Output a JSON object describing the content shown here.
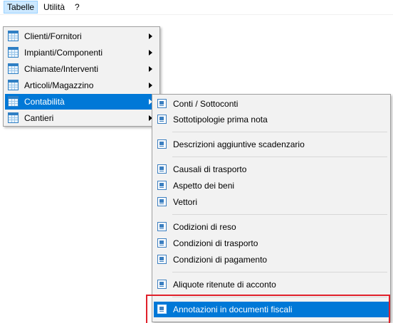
{
  "menubar": {
    "tabelle": "Tabelle",
    "utilita": "Utilità",
    "help": "?"
  },
  "menu_main": {
    "items": [
      {
        "label": "Clienti/Fornitori",
        "icon": "table-icon",
        "submenu": true
      },
      {
        "label": "Impianti/Componenti",
        "icon": "table-icon",
        "submenu": true
      },
      {
        "label": "Chiamate/Interventi",
        "icon": "table-icon",
        "submenu": true
      },
      {
        "label": "Articoli/Magazzino",
        "icon": "table-icon",
        "submenu": true
      },
      {
        "label": "Contabilità",
        "icon": "table-icon",
        "submenu": true,
        "highlighted": true
      },
      {
        "label": "Cantieri",
        "icon": "table-icon",
        "submenu": true
      }
    ]
  },
  "menu_contabilita": {
    "items": [
      {
        "label": "Conti / Sottoconti",
        "icon": "document-icon"
      },
      {
        "label": "Sottotipologie prima nota",
        "icon": "document-icon"
      },
      {
        "label": "Descrizioni aggiuntive scadenzario",
        "icon": "document-icon"
      },
      {
        "label": "Causali di trasporto",
        "icon": "document-icon"
      },
      {
        "label": "Aspetto dei beni",
        "icon": "document-icon"
      },
      {
        "label": "Vettori",
        "icon": "document-icon"
      },
      {
        "label": "Codizioni di reso",
        "icon": "document-icon"
      },
      {
        "label": "Condizioni di trasporto",
        "icon": "document-icon"
      },
      {
        "label": "Condizioni di pagamento",
        "icon": "document-icon"
      },
      {
        "label": "Aliquote ritenute di acconto",
        "icon": "document-icon"
      },
      {
        "label": "Annotazioni in documenti fiscali",
        "icon": "document-icon",
        "highlighted": true
      }
    ]
  },
  "colors": {
    "highlight": "#0078d7",
    "annotation_box": "#e0202a",
    "menubar_active": "#cce8ff"
  }
}
